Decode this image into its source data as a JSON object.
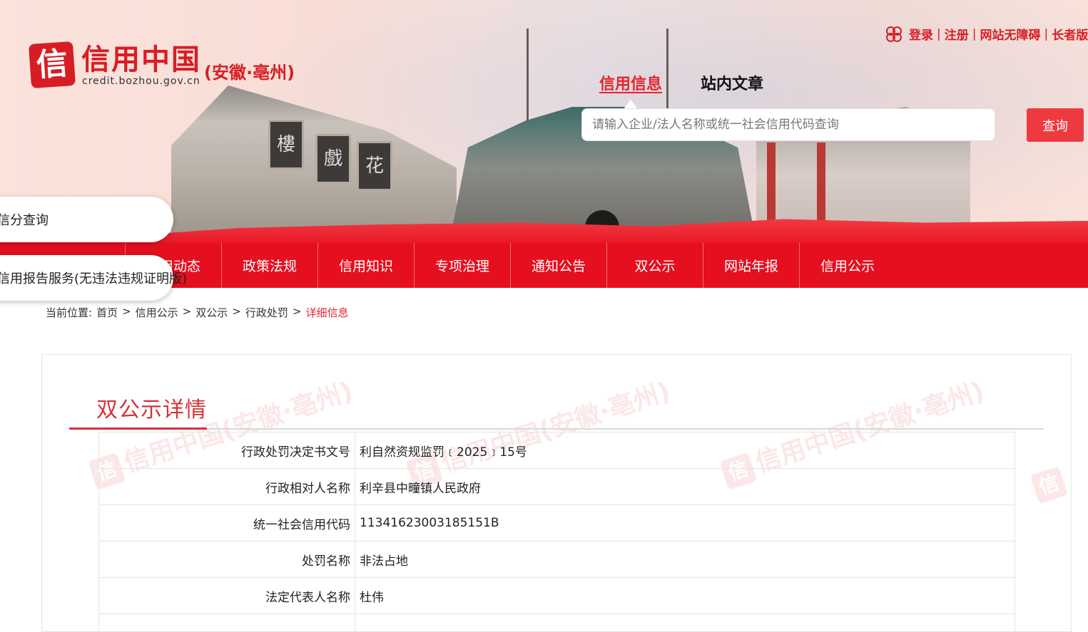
{
  "logo": {
    "icon_char": "信",
    "name": "信用中国",
    "region": "(安徽·亳州)",
    "url": "credit.bozhou.gov.cn"
  },
  "top_links": {
    "login": "登录",
    "register": "注册",
    "accessible": "网站无障碍",
    "elder": "长者版"
  },
  "search": {
    "tabs": [
      "信用信息",
      "站内文章"
    ],
    "placeholder": "请输入企业/法人名称或统一社会信用代码查询",
    "button": "查询"
  },
  "banner_plaques": [
    "樓",
    "戲",
    "花"
  ],
  "floating": [
    "信分查询",
    "信用报告服务(无违法违规证明版)"
  ],
  "nav": [
    "信用动态",
    "政策法规",
    "信用知识",
    "专项治理",
    "通知公告",
    "双公示",
    "网站年报",
    "信用公示"
  ],
  "breadcrumb": {
    "prefix": "当前位置:",
    "items": [
      "首页",
      "信用公示",
      "双公示",
      "行政处罚"
    ],
    "separator": ">",
    "current": "详细信息"
  },
  "panel": {
    "title": "双公示详情",
    "watermark_text": "信用中国(安徽·亳州)"
  },
  "details": [
    {
      "label": "行政处罚决定书文号",
      "value": "利自然资规监罚﹝2025﹞15号"
    },
    {
      "label": "行政相对人名称",
      "value": "利辛县中疃镇人民政府"
    },
    {
      "label": "统一社会信用代码",
      "value": "11341623003185151B"
    },
    {
      "label": "处罚名称",
      "value": "非法占地"
    },
    {
      "label": "法定代表人名称",
      "value": "杜伟"
    }
  ],
  "colors": {
    "brand_red": "#e60f1f",
    "accent_red": "#d8323a",
    "search_button": "#ee3a3f"
  }
}
